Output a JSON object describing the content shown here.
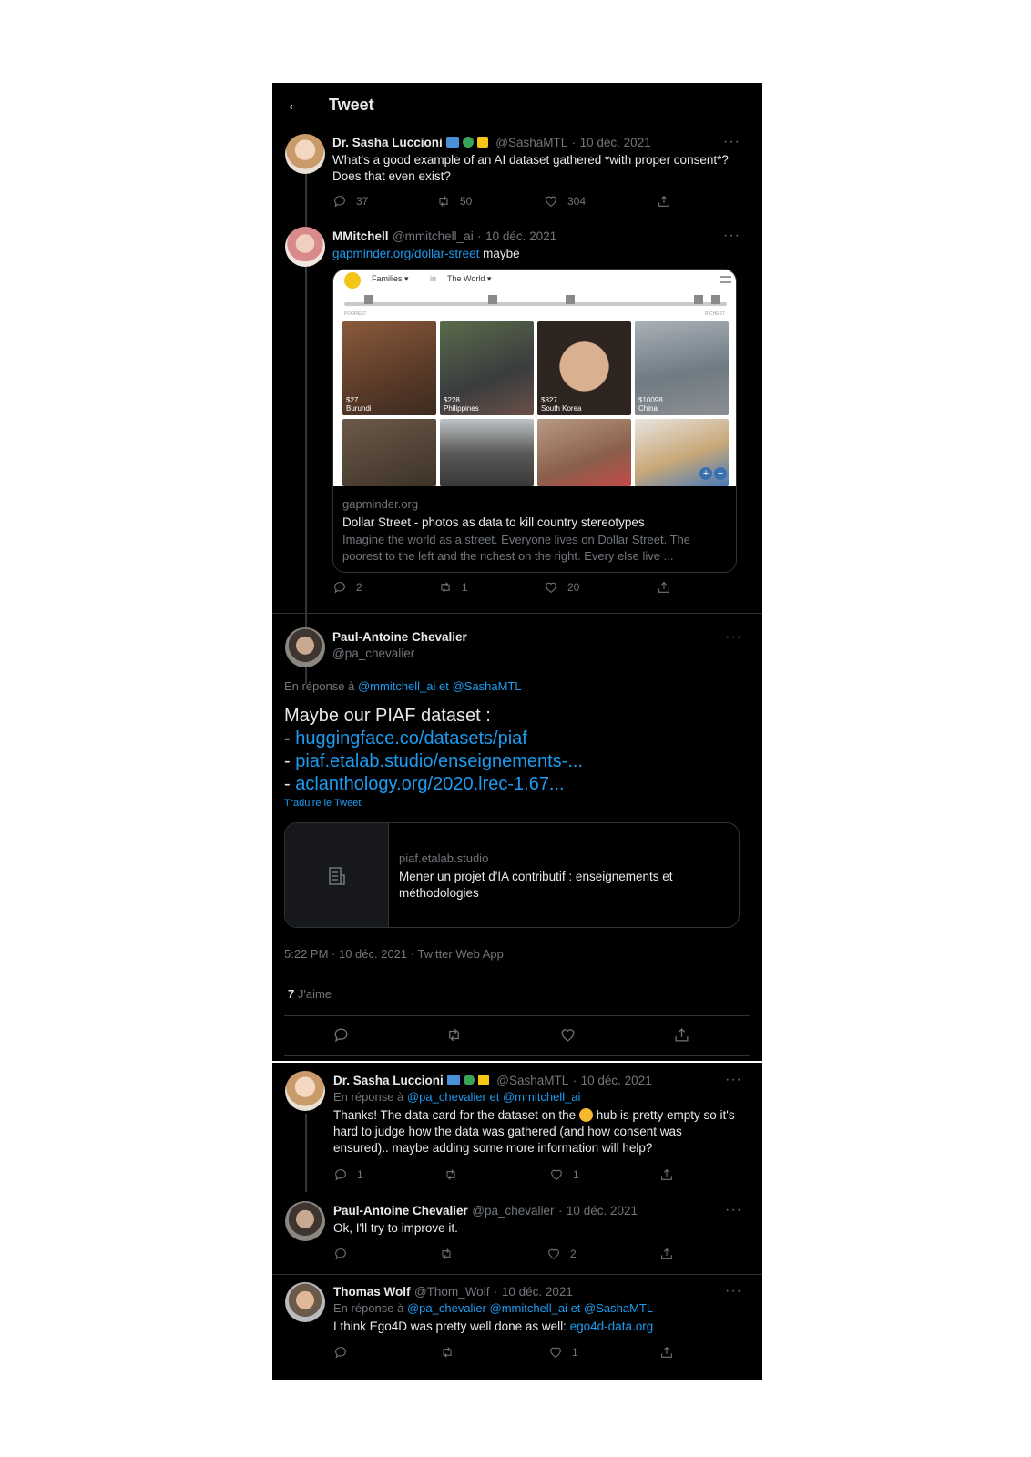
{
  "header": {
    "title": "Tweet"
  },
  "tweet1": {
    "name": "Dr. Sasha Luccioni",
    "handle": "@SashaMTL",
    "date": "10 déc. 2021",
    "text": "What's a good example of an AI dataset gathered *with proper consent*? Does that even exist?",
    "replies": "37",
    "retweets": "50",
    "likes": "304"
  },
  "tweet2": {
    "name": "MMitchell",
    "handle": "@mmitchell_ai",
    "date": "10 déc. 2021",
    "link": "gapminder.org/dollar-street",
    "text_after": " maybe",
    "card": {
      "toolbar_families": "Families ▾",
      "toolbar_in": "in",
      "toolbar_world": "The World ▾",
      "poorest": "POOREST",
      "richest": "RICHEST",
      "photos": [
        {
          "amount": "$27",
          "country": "Burundi"
        },
        {
          "amount": "$228",
          "country": "Philippines"
        },
        {
          "amount": "$827",
          "country": "South Korea"
        },
        {
          "amount": "$10098",
          "country": "China"
        }
      ],
      "domain": "gapminder.org",
      "title": "Dollar Street - photos as data to kill country stereotypes",
      "description": "Imagine the world as a street. Everyone lives on Dollar Street. The poorest to the left and the richest on the right. Every else live ..."
    },
    "replies": "2",
    "retweets": "1",
    "likes": "20"
  },
  "main": {
    "name": "Paul-Antoine Chevalier",
    "handle": "@pa_chevalier",
    "reply_prefix": "En réponse à",
    "reply_user1": "@mmitchell_ai",
    "reply_and": "et",
    "reply_user2": "@SashaMTL",
    "line1": "Maybe our PIAF dataset :",
    "dash": "-",
    "link1": "huggingface.co/datasets/piaf",
    "link2": "piaf.etalab.studio/enseignements-...",
    "link3": "aclanthology.org/2020.lrec-1.67...",
    "translate": "Traduire le Tweet",
    "card_domain": "piaf.etalab.studio",
    "card_title": "Mener un projet d'IA contributif : enseignements et méthodologies",
    "timestamp": "5:22 PM · 10 déc. 2021 · Twitter Web App",
    "likes_count": "7",
    "likes_label": "J'aime"
  },
  "reply1": {
    "name": "Dr. Sasha Luccioni",
    "handle": "@SashaMTL",
    "date": "10 déc. 2021",
    "reply_prefix": "En réponse à",
    "reply_user1": "@pa_chevalier",
    "reply_and": "et",
    "reply_user2": "@mmitchell_ai",
    "text_before": "Thanks! The data card for the dataset on the",
    "text_after": "hub is pretty empty so it's hard to judge how the data was gathered (and how consent was ensured).. maybe adding some more information will help?",
    "replies": "1",
    "likes": "1"
  },
  "reply2": {
    "name": "Paul-Antoine Chevalier",
    "handle": "@pa_chevalier",
    "date": "10 déc. 2021",
    "text": "Ok, I'll try to improve it.",
    "likes": "2"
  },
  "reply3": {
    "name": "Thomas Wolf",
    "handle": "@Thom_Wolf",
    "date": "10 déc. 2021",
    "reply_prefix": "En réponse à",
    "reply_users": "@pa_chevalier @mmitchell_ai",
    "reply_and": "et",
    "reply_user3": "@SashaMTL",
    "text": "I think Ego4D was pretty well done as well:",
    "link": "ego4d-data.org",
    "likes": "1"
  },
  "colors": {
    "background": "#000000",
    "text": "#e7e9ea",
    "muted": "#71767b",
    "link": "#1d9bf0",
    "border": "#2f3336"
  }
}
